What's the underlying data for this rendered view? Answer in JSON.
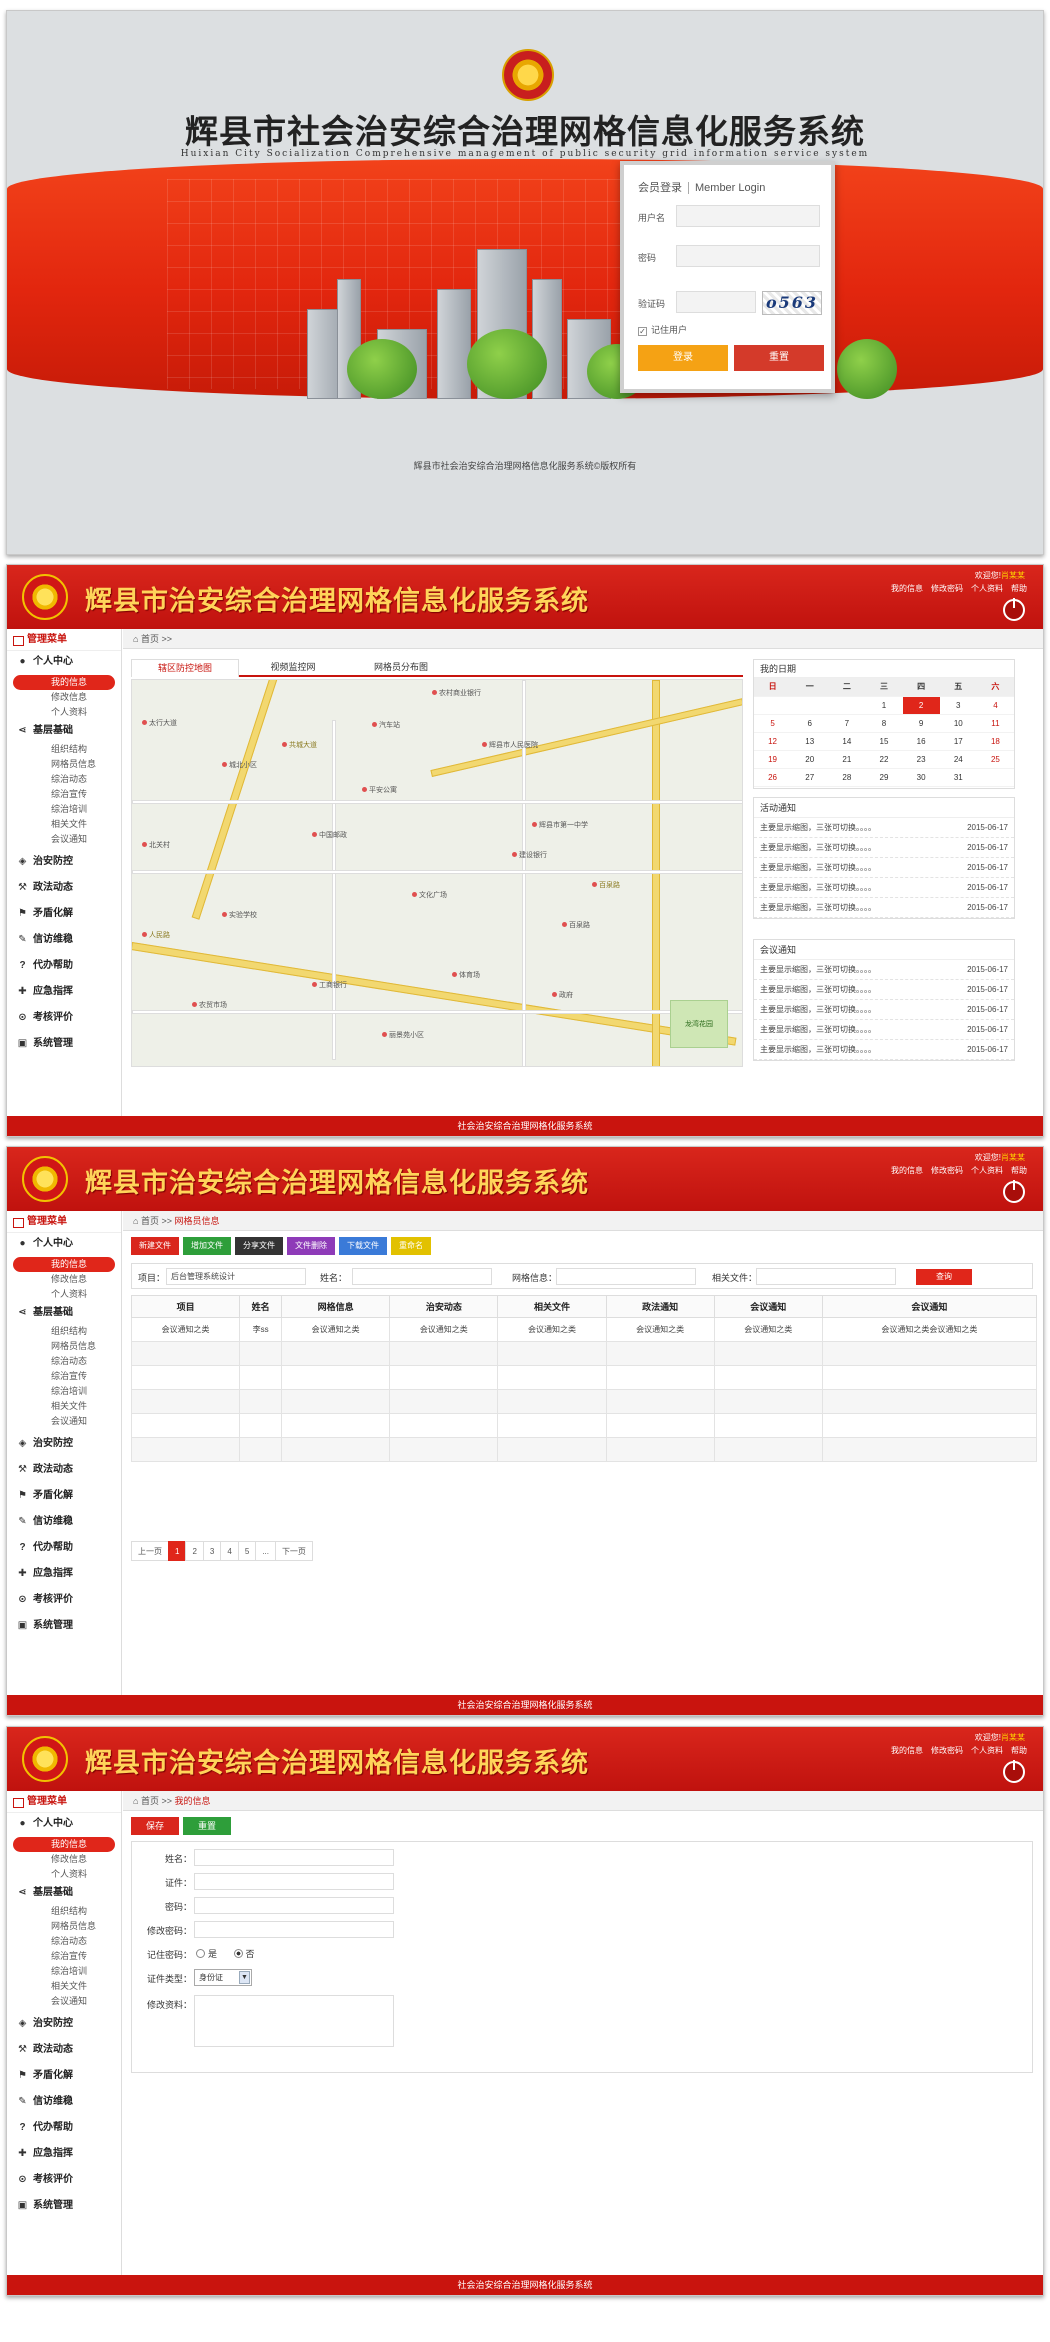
{
  "login": {
    "title": "辉县市社会治安综合治理网格信息化服务系统",
    "subtitle": "Huixian City Socialization Comprehensive management of public security grid information service system",
    "box_title": "会员登录",
    "box_title_en": "Member Login",
    "username_label": "用户名",
    "password_label": "密码",
    "captcha_label": "验证码",
    "captcha_value": "o563",
    "remember_label": "记住用户",
    "login_button": "登录",
    "reset_button": "重置",
    "footer": "辉县市社会治安综合治理网格信息化服务系统©版权所有"
  },
  "header": {
    "title": "辉县市治安综合治理网格信息化服务系统",
    "welcome": "欢迎您!",
    "user": "肖某某",
    "links": [
      "我的信息",
      "修改密码",
      "个人资料",
      "帮助"
    ]
  },
  "sidebar": {
    "title": "管理菜单",
    "personal": {
      "label": "个人中心",
      "items": [
        "我的信息",
        "修改信息",
        "个人资料"
      ]
    },
    "grassroots": {
      "label": "基层基础",
      "items": [
        "组织结构",
        "网格员信息",
        "综治动态",
        "综治宣传",
        "综治培训",
        "相关文件",
        "会议通知"
      ]
    },
    "sections": [
      "治安防控",
      "政法动态",
      "矛盾化解",
      "信访维稳",
      "代办帮助",
      "应急指挥",
      "考核评价",
      "系统管理"
    ]
  },
  "footer": {
    "text": "社会治安综合治理网格化服务系统"
  },
  "dashboard": {
    "crumb_home": "首页",
    "map_tabs": [
      "辖区防控地图",
      "视频监控网",
      "网格员分布图"
    ],
    "map_labels": [
      "龙湾花园",
      "丽景苑小区",
      "农村商业银行",
      "工商银行",
      "汽车站",
      "辉县市人民医院",
      "平安公寓",
      "文化广场",
      "辉县市第一中学",
      "中国邮政",
      "建设银行",
      "百泉路",
      "共城大道",
      "人民路",
      "太行大道",
      "城北小区",
      "北关村",
      "实验学校",
      "体育场",
      "农贸市场",
      "政府"
    ],
    "calendar": {
      "title": "我的日期",
      "weekdays": [
        "日",
        "一",
        "二",
        "三",
        "四",
        "五",
        "六"
      ],
      "weeks": [
        [
          "",
          "",
          "",
          "1",
          "2",
          "3",
          "4"
        ],
        [
          "5",
          "6",
          "7",
          "8",
          "9",
          "10",
          "11"
        ],
        [
          "12",
          "13",
          "14",
          "15",
          "16",
          "17",
          "18"
        ],
        [
          "19",
          "20",
          "21",
          "22",
          "23",
          "24",
          "25"
        ],
        [
          "26",
          "27",
          "28",
          "29",
          "30",
          "31",
          ""
        ]
      ],
      "today": "2"
    },
    "activity": {
      "title": "活动通知",
      "items": [
        {
          "text": "主要显示缩图，三张可切换。。。。",
          "date": "2015-06-17"
        },
        {
          "text": "主要显示缩图，三张可切换。。。。",
          "date": "2015-06-17"
        },
        {
          "text": "主要显示缩图，三张可切换。。。。",
          "date": "2015-06-17"
        },
        {
          "text": "主要显示缩图，三张可切换。。。。",
          "date": "2015-06-17"
        },
        {
          "text": "主要显示缩图，三张可切换。。。。",
          "date": "2015-06-17"
        }
      ]
    },
    "meeting": {
      "title": "会议通知",
      "items": [
        {
          "text": "主要显示缩图，三张可切换。。。。",
          "date": "2015-06-17"
        },
        {
          "text": "主要显示缩图，三张可切换。。。。",
          "date": "2015-06-17"
        },
        {
          "text": "主要显示缩图，三张可切换。。。。",
          "date": "2015-06-17"
        },
        {
          "text": "主要显示缩图，三张可切换。。。。",
          "date": "2015-06-17"
        },
        {
          "text": "主要显示缩图，三张可切换。。。。",
          "date": "2015-06-17"
        }
      ]
    }
  },
  "gridlist": {
    "crumb_home": "首页",
    "crumb_current": "网格员信息",
    "toolbar": [
      {
        "label": "新建文件",
        "color": "#d9261c"
      },
      {
        "label": "增加文件",
        "color": "#2e9e3a"
      },
      {
        "label": "分享文件",
        "color": "#333333"
      },
      {
        "label": "文件删除",
        "color": "#8e3bb8"
      },
      {
        "label": "下载文件",
        "color": "#3a7ad8"
      },
      {
        "label": "重命名",
        "color": "#e2c100"
      }
    ],
    "search": {
      "project_label": "项目：",
      "project_value": "后台管理系统设计",
      "name_label": "姓名：",
      "grid_label": "网格信息：",
      "files_label": "相关文件：",
      "button": "查询"
    },
    "columns": [
      "项目",
      "姓名",
      "网格信息",
      "治安动态",
      "相关文件",
      "政法通知",
      "会议通知",
      "会议通知"
    ],
    "rows": [
      [
        "会议通知之类",
        "李ss",
        "会议通知之类",
        "会议通知之类",
        "会议通知之类",
        "会议通知之类",
        "会议通知之类",
        "会议通知之类会议通知之类"
      ],
      [
        "",
        "",
        "",
        "",
        "",
        "",
        "",
        ""
      ],
      [
        "",
        "",
        "",
        "",
        "",
        "",
        "",
        ""
      ],
      [
        "",
        "",
        "",
        "",
        "",
        "",
        "",
        ""
      ],
      [
        "",
        "",
        "",
        "",
        "",
        "",
        "",
        ""
      ],
      [
        "",
        "",
        "",
        "",
        "",
        "",
        "",
        ""
      ]
    ],
    "pager": {
      "prev": "上一页",
      "pages": [
        "1",
        "2",
        "3",
        "4",
        "5",
        "..."
      ],
      "next": "下一页",
      "current": "1"
    }
  },
  "profile": {
    "crumb_home": "首页",
    "crumb_current": "我的信息",
    "save_button": "保存",
    "reset_button": "重置",
    "fields": [
      "姓名：",
      "证件：",
      "密码：",
      "修改密码："
    ],
    "remember_label": "记住密码：",
    "remember_yes": "是",
    "remember_no": "否",
    "id_type_label": "证件类型：",
    "id_type_value": "身份证",
    "note_label": "修改资料："
  }
}
